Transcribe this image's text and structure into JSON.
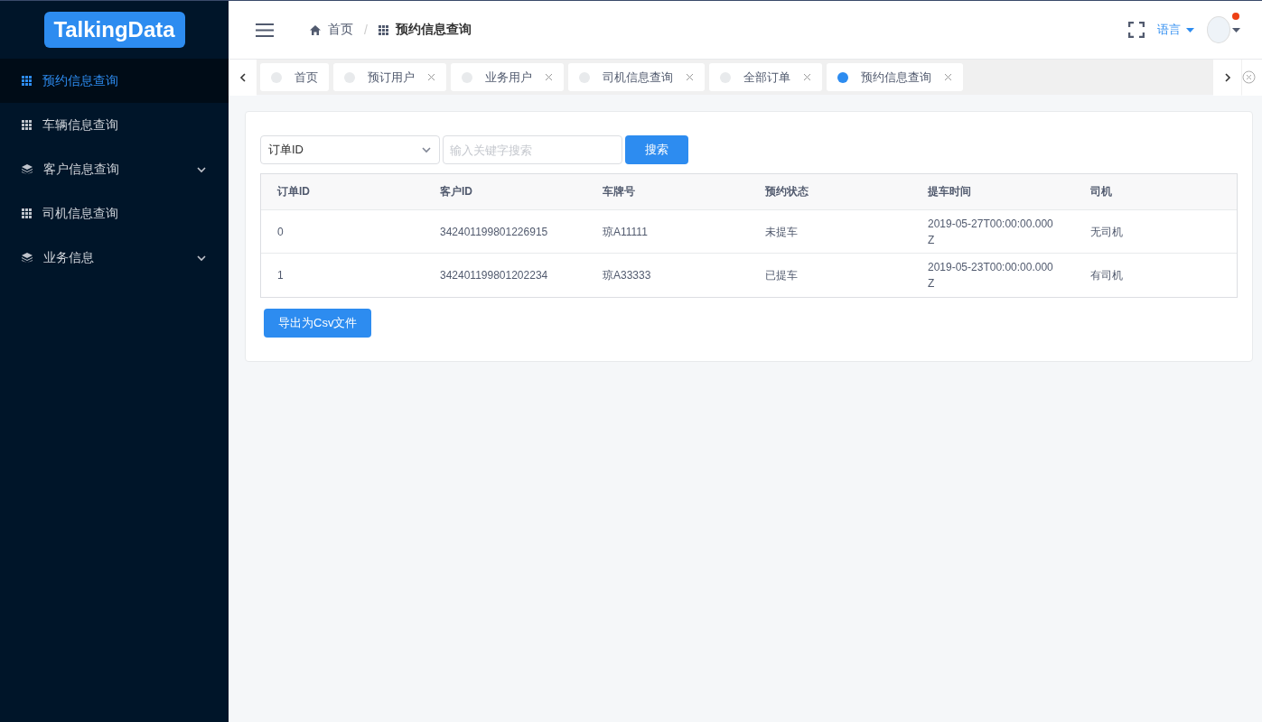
{
  "logo": {
    "text": "TalkingData"
  },
  "sidebar": {
    "items": [
      {
        "label": "预约信息查询",
        "kind": "grid",
        "expandable": false,
        "selected": true
      },
      {
        "label": "车辆信息查询",
        "kind": "grid",
        "expandable": false,
        "selected": false
      },
      {
        "label": "客户信息查询",
        "kind": "layers",
        "expandable": true,
        "selected": false
      },
      {
        "label": "司机信息查询",
        "kind": "grid",
        "expandable": false,
        "selected": false
      },
      {
        "label": "业务信息",
        "kind": "layers",
        "expandable": true,
        "selected": false
      }
    ]
  },
  "header": {
    "breadcrumb": [
      {
        "label": "首页",
        "kind": "home"
      },
      {
        "label": "预约信息查询",
        "kind": "grid"
      }
    ],
    "breadcrumb_separator": "/",
    "language": "语言",
    "notification": true
  },
  "tabs": [
    {
      "label": "首页",
      "closable": false,
      "selected": false
    },
    {
      "label": "预订用户",
      "closable": true,
      "selected": false
    },
    {
      "label": "业务用户",
      "closable": true,
      "selected": false
    },
    {
      "label": "司机信息查询",
      "closable": true,
      "selected": false
    },
    {
      "label": "全部订单",
      "closable": true,
      "selected": false
    },
    {
      "label": "预约信息查询",
      "closable": true,
      "selected": true
    }
  ],
  "filter": {
    "field": "订单ID",
    "placeholder": "输入关键字搜索",
    "search_button": "搜索"
  },
  "table": {
    "columns": [
      "订单ID",
      "客户ID",
      "车牌号",
      "预约状态",
      "提车时间",
      "司机"
    ],
    "rows": [
      [
        "0",
        "342401199801226915",
        "琼A11111",
        "未提车",
        "2019-05-27T00:00:00.000Z",
        "无司机"
      ],
      [
        "1",
        "342401199801202234",
        "琼A33333",
        "已提车",
        "2019-05-23T00:00:00.000Z",
        "有司机"
      ]
    ]
  },
  "export_button": "导出为Csv文件"
}
